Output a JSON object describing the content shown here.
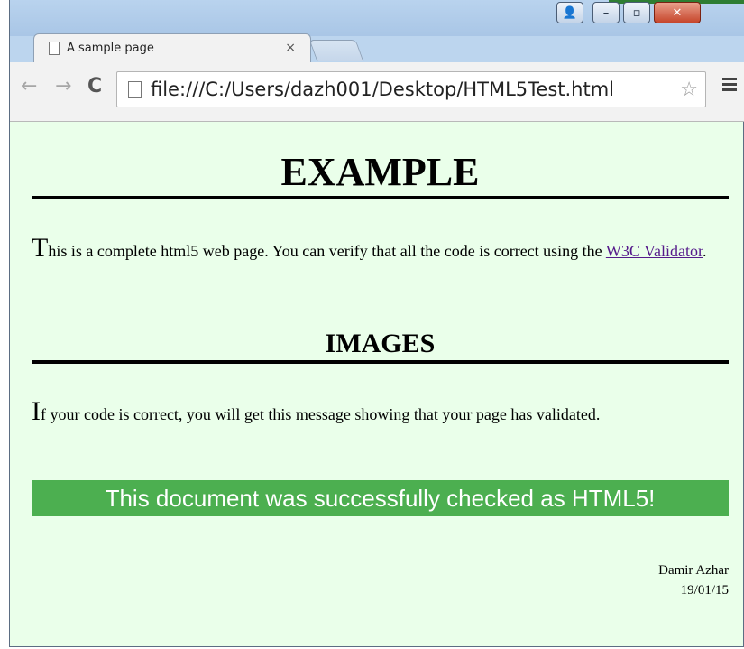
{
  "browser": {
    "tab_title": "A sample page",
    "tab_close": "×",
    "url": "file:///C:/Users/dazh001/Desktop/HTML5Test.html",
    "window_buttons": {
      "user": "👤",
      "minimize": "–",
      "maximize": "▫",
      "close": "✕"
    },
    "nav": {
      "back": "←",
      "forward": "→",
      "reload": "C"
    },
    "star": "☆"
  },
  "page": {
    "heading": "EXAMPLE",
    "intro": {
      "dropcap": "T",
      "text": "his is a complete html5 web page. You can verify that all the code is correct using the ",
      "link": "W3C Validator",
      "after_link": "."
    },
    "subheading": "IMAGES",
    "images_paragraph": {
      "dropcap": "I",
      "text": "f your code is correct, you will get this message showing that your page has validated."
    },
    "banner": "This document was successfully checked as HTML5!",
    "author": "Damir Azhar",
    "date": "19/01/15"
  },
  "colors": {
    "page_background": "#eaffea",
    "banner_background": "#4caf50",
    "link": "#551a8b"
  }
}
